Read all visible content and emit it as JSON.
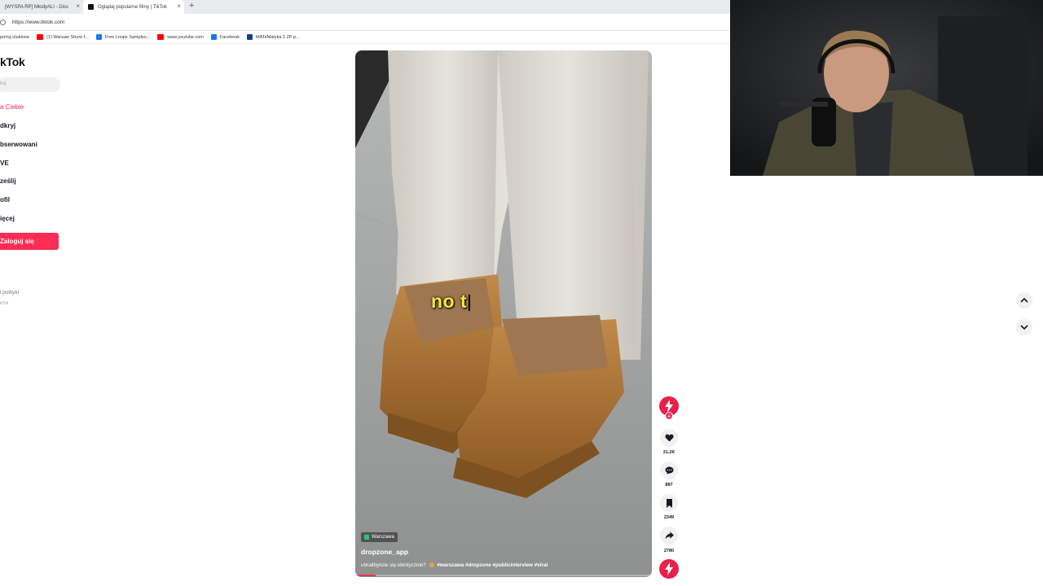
{
  "browser": {
    "tabs": [
      {
        "title": "[WYSPA RP] MłodyALI - Diss",
        "active": false
      },
      {
        "title": "Oglądaj popularne filmy | TikTok",
        "active": true
      }
    ],
    "new_tab_glyph": "+",
    "close_glyph": "×",
    "url": "https://www.tiktok.com",
    "bookmarks": [
      {
        "label": "portuj ulubione",
        "icon": "folder-icon",
        "color": "#9aa0a6"
      },
      {
        "label": "(1) Warsaw Shore f...",
        "icon": "youtube-icon",
        "color": "#ff0000"
      },
      {
        "label": "Free Loops Samples...",
        "icon": "facebook-icon",
        "color": "#1877f2"
      },
      {
        "label": "www.youtube.com",
        "icon": "globe-icon",
        "color": "#5f6368"
      },
      {
        "label": "Facebook",
        "icon": "youtube-icon",
        "color": "#ff0000"
      },
      {
        "label": "MATeMatyka 2 ZP p...",
        "icon": "facebook-icon",
        "color": "#1877f2"
      }
    ]
  },
  "sidebar": {
    "logo": "kTok",
    "search_placeholder": "kaj",
    "nav": [
      {
        "label": "a Ciebie",
        "active": true
      },
      {
        "label": "dkryj",
        "active": false
      },
      {
        "label": "bserwowani",
        "active": false
      },
      {
        "label": "VE",
        "active": false
      },
      {
        "label": "ześlij",
        "active": false
      },
      {
        "label": "ofil",
        "active": false
      },
      {
        "label": "ięcej",
        "active": false
      }
    ],
    "login_label": "Zaloguj się",
    "footer_link": "i polityki",
    "footer_copy": "kTok"
  },
  "video": {
    "caption_overlay": "no t",
    "location_tag": "Warszawa",
    "username": "dropzone_app",
    "description": "ubralibyście się identycznie?",
    "hashtags": "#warszawa #dropzone #publicinterview #viral",
    "progress": 0.07
  },
  "actions": {
    "likes": "31.2K",
    "comments": "887",
    "saves": "2349",
    "shares": "2780",
    "follow_glyph": "+"
  },
  "colors": {
    "brand": "#fe2c55",
    "caption": "#f4e83a"
  }
}
